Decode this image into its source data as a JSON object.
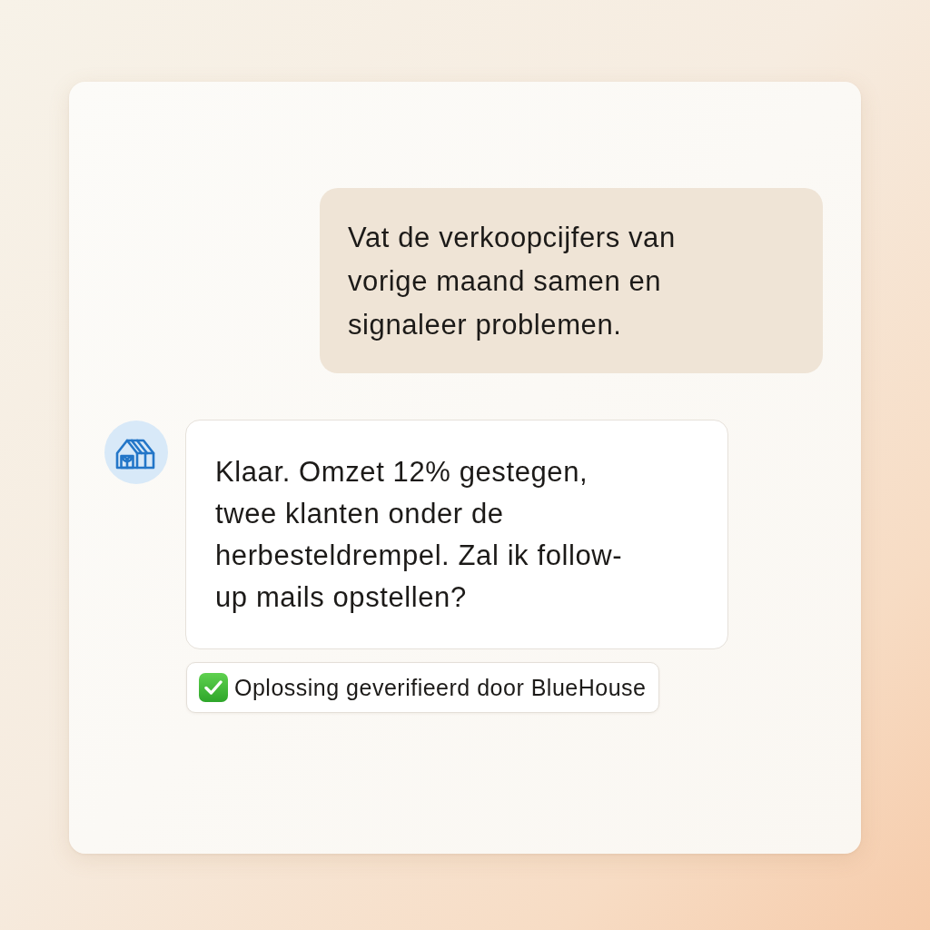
{
  "messages": [
    {
      "kind": "user",
      "text": "Vat de verkoopcijfers van vorige maand samen en signaleer problemen."
    },
    {
      "kind": "assistant",
      "text": "Klaar. Omzet 12% gestegen, twee klanten onder de herbesteldrempel. Zal ik follow-up mails opstellen?",
      "verification": "Oplossing geverifieerd door BlueHouse"
    }
  ]
}
